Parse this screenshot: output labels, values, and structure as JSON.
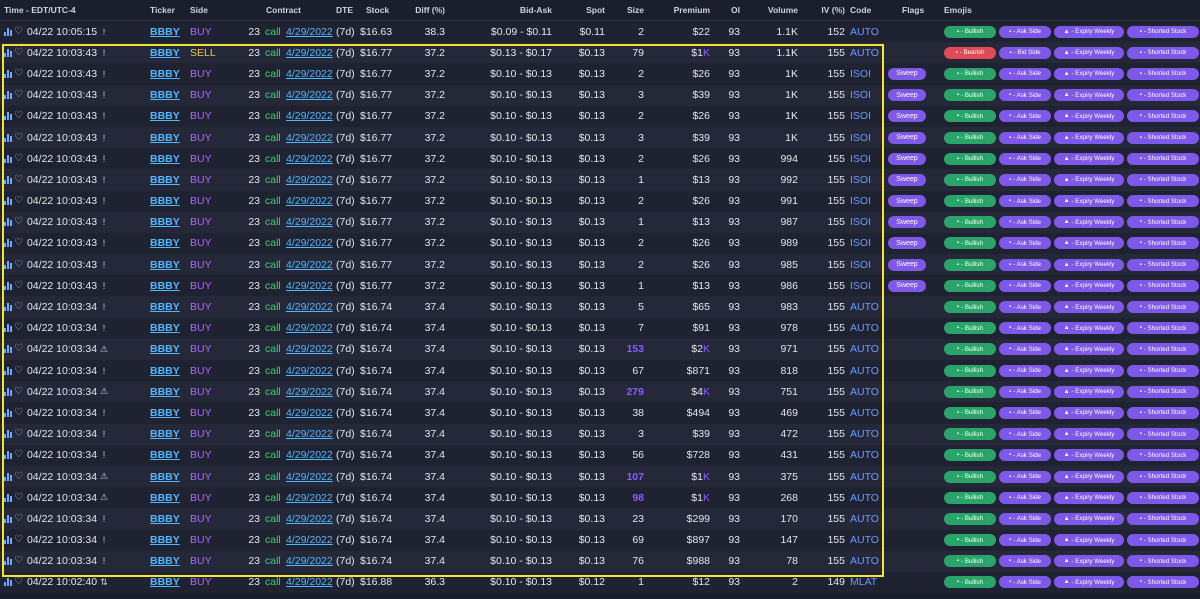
{
  "columns": {
    "time": "Time - EDT/UTC-4",
    "ticker": "Ticker",
    "side": "Side",
    "contract": "Contract",
    "dte": "DTE",
    "stock": "Stock",
    "diff": "Diff (%)",
    "bid_ask": "Bid-Ask",
    "spot": "Spot",
    "size": "Size",
    "premium": "Premium",
    "oi": "OI",
    "volume": "Volume",
    "iv": "IV (%)",
    "code": "Code",
    "flags": "Flags",
    "emojis": "Emojis"
  },
  "pill_text": {
    "bullish": "- Bullish",
    "bearish": "- Bearish",
    "ask_side": "- Ask Side",
    "bid_side": "- Bid Side",
    "expiry_weekly": "- Expiry Weekly",
    "shorted_stock": "- Shorted Stock",
    "sweep": "Sweep"
  },
  "colors": {
    "background": "#1b1e2b",
    "buy": "#b266ff",
    "sell": "#f5c542",
    "call": "#3ad56f",
    "link": "#53b8ff",
    "pill_bullish": "#2aa56a",
    "pill_bearish": "#e04a56",
    "pill_purple": "#7e58e8",
    "selection_outline": "#f4e534"
  },
  "rows": [
    {
      "time": "04/22 10:05:15",
      "alert": "!",
      "ticker": "BBBY",
      "side": "BUY",
      "strike": "23",
      "cp": "call",
      "exp": "4/29/2022",
      "dte": "(7d)",
      "stock": "$16.63",
      "diff": "38.3",
      "bidask": "$0.09 - $0.11",
      "spot": "$0.11",
      "size": "2",
      "premium": "$22",
      "oi": "93",
      "volume": "1.1K",
      "iv": "152",
      "code": "AUTO",
      "flag": "",
      "sentiment": "bullish",
      "sidepill": "ask_side"
    },
    {
      "time": "04/22 10:03:43",
      "alert": "!",
      "ticker": "BBBY",
      "side": "SELL",
      "strike": "23",
      "cp": "call",
      "exp": "4/29/2022",
      "dte": "(7d)",
      "stock": "$16.77",
      "diff": "37.2",
      "bidask": "$0.13 - $0.17",
      "spot": "$0.13",
      "size": "79",
      "premium": "$1K",
      "oi": "93",
      "volume": "1.1K",
      "iv": "155",
      "code": "AUTO",
      "flag": "",
      "sentiment": "bearish",
      "sidepill": "bid_side"
    },
    {
      "time": "04/22 10:03:43",
      "alert": "!",
      "ticker": "BBBY",
      "side": "BUY",
      "strike": "23",
      "cp": "call",
      "exp": "4/29/2022",
      "dte": "(7d)",
      "stock": "$16.77",
      "diff": "37.2",
      "bidask": "$0.10 - $0.13",
      "spot": "$0.13",
      "size": "2",
      "premium": "$26",
      "oi": "93",
      "volume": "1K",
      "iv": "155",
      "code": "ISOI",
      "flag": "Sweep",
      "sentiment": "bullish",
      "sidepill": "ask_side"
    },
    {
      "time": "04/22 10:03:43",
      "alert": "!",
      "ticker": "BBBY",
      "side": "BUY",
      "strike": "23",
      "cp": "call",
      "exp": "4/29/2022",
      "dte": "(7d)",
      "stock": "$16.77",
      "diff": "37.2",
      "bidask": "$0.10 - $0.13",
      "spot": "$0.13",
      "size": "3",
      "premium": "$39",
      "oi": "93",
      "volume": "1K",
      "iv": "155",
      "code": "ISOI",
      "flag": "Sweep",
      "sentiment": "bullish",
      "sidepill": "ask_side"
    },
    {
      "time": "04/22 10:03:43",
      "alert": "!",
      "ticker": "BBBY",
      "side": "BUY",
      "strike": "23",
      "cp": "call",
      "exp": "4/29/2022",
      "dte": "(7d)",
      "stock": "$16.77",
      "diff": "37.2",
      "bidask": "$0.10 - $0.13",
      "spot": "$0.13",
      "size": "2",
      "premium": "$26",
      "oi": "93",
      "volume": "1K",
      "iv": "155",
      "code": "ISOI",
      "flag": "Sweep",
      "sentiment": "bullish",
      "sidepill": "ask_side"
    },
    {
      "time": "04/22 10:03:43",
      "alert": "!",
      "ticker": "BBBY",
      "side": "BUY",
      "strike": "23",
      "cp": "call",
      "exp": "4/29/2022",
      "dte": "(7d)",
      "stock": "$16.77",
      "diff": "37.2",
      "bidask": "$0.10 - $0.13",
      "spot": "$0.13",
      "size": "3",
      "premium": "$39",
      "oi": "93",
      "volume": "1K",
      "iv": "155",
      "code": "ISOI",
      "flag": "Sweep",
      "sentiment": "bullish",
      "sidepill": "ask_side"
    },
    {
      "time": "04/22 10:03:43",
      "alert": "!",
      "ticker": "BBBY",
      "side": "BUY",
      "strike": "23",
      "cp": "call",
      "exp": "4/29/2022",
      "dte": "(7d)",
      "stock": "$16.77",
      "diff": "37.2",
      "bidask": "$0.10 - $0.13",
      "spot": "$0.13",
      "size": "2",
      "premium": "$26",
      "oi": "93",
      "volume": "994",
      "iv": "155",
      "code": "ISOI",
      "flag": "Sweep",
      "sentiment": "bullish",
      "sidepill": "ask_side"
    },
    {
      "time": "04/22 10:03:43",
      "alert": "!",
      "ticker": "BBBY",
      "side": "BUY",
      "strike": "23",
      "cp": "call",
      "exp": "4/29/2022",
      "dte": "(7d)",
      "stock": "$16.77",
      "diff": "37.2",
      "bidask": "$0.10 - $0.13",
      "spot": "$0.13",
      "size": "1",
      "premium": "$13",
      "oi": "93",
      "volume": "992",
      "iv": "155",
      "code": "ISOI",
      "flag": "Sweep",
      "sentiment": "bullish",
      "sidepill": "ask_side"
    },
    {
      "time": "04/22 10:03:43",
      "alert": "!",
      "ticker": "BBBY",
      "side": "BUY",
      "strike": "23",
      "cp": "call",
      "exp": "4/29/2022",
      "dte": "(7d)",
      "stock": "$16.77",
      "diff": "37.2",
      "bidask": "$0.10 - $0.13",
      "spot": "$0.13",
      "size": "2",
      "premium": "$26",
      "oi": "93",
      "volume": "991",
      "iv": "155",
      "code": "ISOI",
      "flag": "Sweep",
      "sentiment": "bullish",
      "sidepill": "ask_side"
    },
    {
      "time": "04/22 10:03:43",
      "alert": "!",
      "ticker": "BBBY",
      "side": "BUY",
      "strike": "23",
      "cp": "call",
      "exp": "4/29/2022",
      "dte": "(7d)",
      "stock": "$16.77",
      "diff": "37.2",
      "bidask": "$0.10 - $0.13",
      "spot": "$0.13",
      "size": "1",
      "premium": "$13",
      "oi": "93",
      "volume": "987",
      "iv": "155",
      "code": "ISOI",
      "flag": "Sweep",
      "sentiment": "bullish",
      "sidepill": "ask_side"
    },
    {
      "time": "04/22 10:03:43",
      "alert": "!",
      "ticker": "BBBY",
      "side": "BUY",
      "strike": "23",
      "cp": "call",
      "exp": "4/29/2022",
      "dte": "(7d)",
      "stock": "$16.77",
      "diff": "37.2",
      "bidask": "$0.10 - $0.13",
      "spot": "$0.13",
      "size": "2",
      "premium": "$26",
      "oi": "93",
      "volume": "989",
      "iv": "155",
      "code": "ISOI",
      "flag": "Sweep",
      "sentiment": "bullish",
      "sidepill": "ask_side"
    },
    {
      "time": "04/22 10:03:43",
      "alert": "!",
      "ticker": "BBBY",
      "side": "BUY",
      "strike": "23",
      "cp": "call",
      "exp": "4/29/2022",
      "dte": "(7d)",
      "stock": "$16.77",
      "diff": "37.2",
      "bidask": "$0.10 - $0.13",
      "spot": "$0.13",
      "size": "2",
      "premium": "$26",
      "oi": "93",
      "volume": "985",
      "iv": "155",
      "code": "ISOI",
      "flag": "Sweep",
      "sentiment": "bullish",
      "sidepill": "ask_side"
    },
    {
      "time": "04/22 10:03:43",
      "alert": "!",
      "ticker": "BBBY",
      "side": "BUY",
      "strike": "23",
      "cp": "call",
      "exp": "4/29/2022",
      "dte": "(7d)",
      "stock": "$16.77",
      "diff": "37.2",
      "bidask": "$0.10 - $0.13",
      "spot": "$0.13",
      "size": "1",
      "premium": "$13",
      "oi": "93",
      "volume": "986",
      "iv": "155",
      "code": "ISOI",
      "flag": "Sweep",
      "sentiment": "bullish",
      "sidepill": "ask_side"
    },
    {
      "time": "04/22 10:03:34",
      "alert": "!",
      "ticker": "BBBY",
      "side": "BUY",
      "strike": "23",
      "cp": "call",
      "exp": "4/29/2022",
      "dte": "(7d)",
      "stock": "$16.74",
      "diff": "37.4",
      "bidask": "$0.10 - $0.13",
      "spot": "$0.13",
      "size": "5",
      "premium": "$65",
      "oi": "93",
      "volume": "983",
      "iv": "155",
      "code": "AUTO",
      "flag": "",
      "sentiment": "bullish",
      "sidepill": "ask_side"
    },
    {
      "time": "04/22 10:03:34",
      "alert": "!",
      "ticker": "BBBY",
      "side": "BUY",
      "strike": "23",
      "cp": "call",
      "exp": "4/29/2022",
      "dte": "(7d)",
      "stock": "$16.74",
      "diff": "37.4",
      "bidask": "$0.10 - $0.13",
      "spot": "$0.13",
      "size": "7",
      "premium": "$91",
      "oi": "93",
      "volume": "978",
      "iv": "155",
      "code": "AUTO",
      "flag": "",
      "sentiment": "bullish",
      "sidepill": "ask_side"
    },
    {
      "time": "04/22 10:03:34",
      "alert": "⚠",
      "ticker": "BBBY",
      "side": "BUY",
      "strike": "23",
      "cp": "call",
      "exp": "4/29/2022",
      "dte": "(7d)",
      "stock": "$16.74",
      "diff": "37.4",
      "bidask": "$0.10 - $0.13",
      "spot": "$0.13",
      "size": "153",
      "premium": "$2K",
      "oi": "93",
      "volume": "971",
      "iv": "155",
      "code": "AUTO",
      "flag": "",
      "sentiment": "bullish",
      "sidepill": "ask_side",
      "hl": true
    },
    {
      "time": "04/22 10:03:34",
      "alert": "!",
      "ticker": "BBBY",
      "side": "BUY",
      "strike": "23",
      "cp": "call",
      "exp": "4/29/2022",
      "dte": "(7d)",
      "stock": "$16.74",
      "diff": "37.4",
      "bidask": "$0.10 - $0.13",
      "spot": "$0.13",
      "size": "67",
      "premium": "$871",
      "oi": "93",
      "volume": "818",
      "iv": "155",
      "code": "AUTO",
      "flag": "",
      "sentiment": "bullish",
      "sidepill": "ask_side"
    },
    {
      "time": "04/22 10:03:34",
      "alert": "⚠",
      "ticker": "BBBY",
      "side": "BUY",
      "strike": "23",
      "cp": "call",
      "exp": "4/29/2022",
      "dte": "(7d)",
      "stock": "$16.74",
      "diff": "37.4",
      "bidask": "$0.10 - $0.13",
      "spot": "$0.13",
      "size": "279",
      "premium": "$4K",
      "oi": "93",
      "volume": "751",
      "iv": "155",
      "code": "AUTO",
      "flag": "",
      "sentiment": "bullish",
      "sidepill": "ask_side",
      "hl": true
    },
    {
      "time": "04/22 10:03:34",
      "alert": "!",
      "ticker": "BBBY",
      "side": "BUY",
      "strike": "23",
      "cp": "call",
      "exp": "4/29/2022",
      "dte": "(7d)",
      "stock": "$16.74",
      "diff": "37.4",
      "bidask": "$0.10 - $0.13",
      "spot": "$0.13",
      "size": "38",
      "premium": "$494",
      "oi": "93",
      "volume": "469",
      "iv": "155",
      "code": "AUTO",
      "flag": "",
      "sentiment": "bullish",
      "sidepill": "ask_side"
    },
    {
      "time": "04/22 10:03:34",
      "alert": "!",
      "ticker": "BBBY",
      "side": "BUY",
      "strike": "23",
      "cp": "call",
      "exp": "4/29/2022",
      "dte": "(7d)",
      "stock": "$16.74",
      "diff": "37.4",
      "bidask": "$0.10 - $0.13",
      "spot": "$0.13",
      "size": "3",
      "premium": "$39",
      "oi": "93",
      "volume": "472",
      "iv": "155",
      "code": "AUTO",
      "flag": "",
      "sentiment": "bullish",
      "sidepill": "ask_side"
    },
    {
      "time": "04/22 10:03:34",
      "alert": "!",
      "ticker": "BBBY",
      "side": "BUY",
      "strike": "23",
      "cp": "call",
      "exp": "4/29/2022",
      "dte": "(7d)",
      "stock": "$16.74",
      "diff": "37.4",
      "bidask": "$0.10 - $0.13",
      "spot": "$0.13",
      "size": "56",
      "premium": "$728",
      "oi": "93",
      "volume": "431",
      "iv": "155",
      "code": "AUTO",
      "flag": "",
      "sentiment": "bullish",
      "sidepill": "ask_side"
    },
    {
      "time": "04/22 10:03:34",
      "alert": "⚠",
      "ticker": "BBBY",
      "side": "BUY",
      "strike": "23",
      "cp": "call",
      "exp": "4/29/2022",
      "dte": "(7d)",
      "stock": "$16.74",
      "diff": "37.4",
      "bidask": "$0.10 - $0.13",
      "spot": "$0.13",
      "size": "107",
      "premium": "$1K",
      "oi": "93",
      "volume": "375",
      "iv": "155",
      "code": "AUTO",
      "flag": "",
      "sentiment": "bullish",
      "sidepill": "ask_side",
      "hl": true
    },
    {
      "time": "04/22 10:03:34",
      "alert": "⚠",
      "ticker": "BBBY",
      "side": "BUY",
      "strike": "23",
      "cp": "call",
      "exp": "4/29/2022",
      "dte": "(7d)",
      "stock": "$16.74",
      "diff": "37.4",
      "bidask": "$0.10 - $0.13",
      "spot": "$0.13",
      "size": "98",
      "premium": "$1K",
      "oi": "93",
      "volume": "268",
      "iv": "155",
      "code": "AUTO",
      "flag": "",
      "sentiment": "bullish",
      "sidepill": "ask_side",
      "hl": true
    },
    {
      "time": "04/22 10:03:34",
      "alert": "!",
      "ticker": "BBBY",
      "side": "BUY",
      "strike": "23",
      "cp": "call",
      "exp": "4/29/2022",
      "dte": "(7d)",
      "stock": "$16.74",
      "diff": "37.4",
      "bidask": "$0.10 - $0.13",
      "spot": "$0.13",
      "size": "23",
      "premium": "$299",
      "oi": "93",
      "volume": "170",
      "iv": "155",
      "code": "AUTO",
      "flag": "",
      "sentiment": "bullish",
      "sidepill": "ask_side"
    },
    {
      "time": "04/22 10:03:34",
      "alert": "!",
      "ticker": "BBBY",
      "side": "BUY",
      "strike": "23",
      "cp": "call",
      "exp": "4/29/2022",
      "dte": "(7d)",
      "stock": "$16.74",
      "diff": "37.4",
      "bidask": "$0.10 - $0.13",
      "spot": "$0.13",
      "size": "69",
      "premium": "$897",
      "oi": "93",
      "volume": "147",
      "iv": "155",
      "code": "AUTO",
      "flag": "",
      "sentiment": "bullish",
      "sidepill": "ask_side"
    },
    {
      "time": "04/22 10:03:34",
      "alert": "!",
      "ticker": "BBBY",
      "side": "BUY",
      "strike": "23",
      "cp": "call",
      "exp": "4/29/2022",
      "dte": "(7d)",
      "stock": "$16.74",
      "diff": "37.4",
      "bidask": "$0.10 - $0.13",
      "spot": "$0.13",
      "size": "76",
      "premium": "$988",
      "oi": "93",
      "volume": "78",
      "iv": "155",
      "code": "AUTO",
      "flag": "",
      "sentiment": "bullish",
      "sidepill": "ask_side"
    },
    {
      "time": "04/22 10:02:40",
      "alert": "⇅",
      "ticker": "BBBY",
      "side": "BUY",
      "strike": "23",
      "cp": "call",
      "exp": "4/29/2022",
      "dte": "(7d)",
      "stock": "$16.88",
      "diff": "36.3",
      "bidask": "$0.10 - $0.13",
      "spot": "$0.12",
      "size": "1",
      "premium": "$12",
      "oi": "93",
      "volume": "2",
      "iv": "149",
      "code": "MLAT",
      "flag": "",
      "sentiment": "bullish",
      "sidepill": "ask_side"
    }
  ]
}
